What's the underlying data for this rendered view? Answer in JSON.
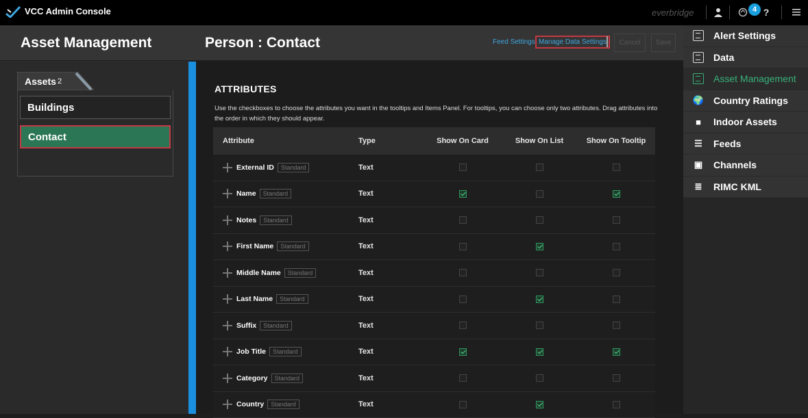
{
  "topbar": {
    "app_title": "VCC Admin Console",
    "brand": "everbridge",
    "notification_count": "4",
    "help": "?"
  },
  "left": {
    "title": "Asset Management",
    "assets_tab": {
      "label": "Assets",
      "count": "2"
    },
    "items": [
      {
        "label": "Buildings",
        "active": false
      },
      {
        "label": "Contact",
        "active": true
      }
    ]
  },
  "main": {
    "title": "Person : Contact",
    "feed_settings": "Feed Settings",
    "manage_data_settings": "Manage Data Settings",
    "cancel": "Cancel",
    "save": "Save",
    "attributes_title": "ATTRIBUTES",
    "attributes_desc": "Use the checkboxes to choose the attributes you want in the tooltips and Items Panel. For tooltips, you can choose only two attributes. Drag attributes into the order in which they should appear.",
    "columns": [
      "Attribute",
      "Type",
      "Show On Card",
      "Show On List",
      "Show On Tooltip"
    ],
    "rows": [
      {
        "name": "External ID",
        "tag": "Standard",
        "type": "Text",
        "card": false,
        "list": false,
        "tooltip": false
      },
      {
        "name": "Name",
        "tag": "Standard",
        "type": "Text",
        "card": true,
        "list": false,
        "tooltip": true
      },
      {
        "name": "Notes",
        "tag": "Standard",
        "type": "Text",
        "card": false,
        "list": false,
        "tooltip": false
      },
      {
        "name": "First Name",
        "tag": "Standard",
        "type": "Text",
        "card": false,
        "list": true,
        "tooltip": false
      },
      {
        "name": "Middle Name",
        "tag": "Standard",
        "type": "Text",
        "card": false,
        "list": false,
        "tooltip": false
      },
      {
        "name": "Last Name",
        "tag": "Standard",
        "type": "Text",
        "card": false,
        "list": true,
        "tooltip": false
      },
      {
        "name": "Suffix",
        "tag": "Standard",
        "type": "Text",
        "card": false,
        "list": false,
        "tooltip": false
      },
      {
        "name": "Job Title",
        "tag": "Standard",
        "type": "Text",
        "card": true,
        "list": true,
        "tooltip": true
      },
      {
        "name": "Category",
        "tag": "Standard",
        "type": "Text",
        "card": false,
        "list": false,
        "tooltip": false
      },
      {
        "name": "Country",
        "tag": "Standard",
        "type": "Text",
        "card": false,
        "list": true,
        "tooltip": false
      }
    ]
  },
  "right": {
    "items": [
      {
        "label": "Alert Settings",
        "icon": "document-icon",
        "active": false
      },
      {
        "label": "Data",
        "icon": "document-icon",
        "active": false
      },
      {
        "label": "Asset Management",
        "icon": "document-icon",
        "active": true
      },
      {
        "label": "Country Ratings",
        "icon": "globe-icon",
        "active": false
      },
      {
        "label": "Indoor Assets",
        "icon": "indoor-icon",
        "active": false
      },
      {
        "label": "Feeds",
        "icon": "feeds-icon",
        "active": false
      },
      {
        "label": "Channels",
        "icon": "channels-icon",
        "active": false
      },
      {
        "label": "RIMC KML",
        "icon": "kml-file-icon",
        "active": false
      }
    ]
  },
  "colors": {
    "accent_green": "#2b7755",
    "link_blue": "#3fa7e0",
    "highlight_red": "#c43a44",
    "strip_blue": "#1a8fe0"
  }
}
